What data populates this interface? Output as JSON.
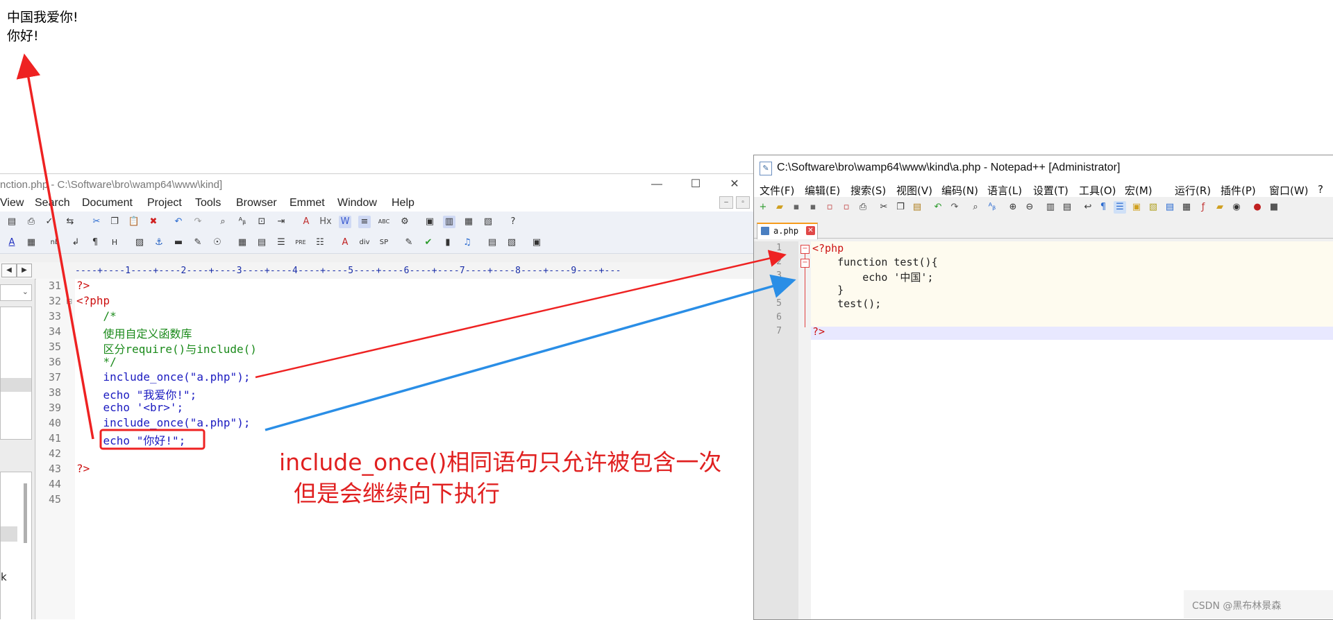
{
  "browser_output": {
    "lines": [
      "中国我爱你!",
      "你好!"
    ]
  },
  "left_window": {
    "title": "nction.php - C:\\Software\\bro\\wamp64\\www\\kind]",
    "window_buttons": [
      "—",
      "☐",
      "✕"
    ],
    "menu": [
      "View",
      "Search",
      "Document",
      "Project",
      "Tools",
      "Browser",
      "Emmet",
      "Window",
      "Help"
    ],
    "ruler": "----+----1----+----2----+----3----+----4----+----5----+----6----+----7----+----8----+----9----+---",
    "side_label": "k",
    "code_lines": [
      {
        "num": "31",
        "text": "?>",
        "color": "#cc1010"
      },
      {
        "num": "32",
        "text": "<?php",
        "color": "#cc1010"
      },
      {
        "num": "33",
        "text": "    /*",
        "color": "#1a8a1a"
      },
      {
        "num": "34",
        "text": "    使用自定义函数库",
        "color": "#1a8a1a"
      },
      {
        "num": "35",
        "text": "    区分require()与include()",
        "color": "#1a8a1a"
      },
      {
        "num": "36",
        "text": "    */",
        "color": "#1a8a1a"
      },
      {
        "num": "37",
        "text": "    include_once(\"a.php\");",
        "color": "#1a1ac0"
      },
      {
        "num": "38",
        "text": "    echo \"我爱你!\";",
        "color": "#1a1ac0"
      },
      {
        "num": "39",
        "text": "    echo '<br>';",
        "color": "#1a1ac0"
      },
      {
        "num": "40",
        "text": "    include_once(\"a.php\");",
        "color": "#1a1ac0"
      },
      {
        "num": "41",
        "text": "    echo \"你好!\";",
        "color": "#1a1ac0"
      },
      {
        "num": "42",
        "text": "",
        "color": "#000000"
      },
      {
        "num": "43",
        "text": "?>",
        "color": "#cc1010"
      },
      {
        "num": "44",
        "text": "",
        "color": "#000000"
      },
      {
        "num": "45",
        "text": "",
        "color": "#000000"
      }
    ]
  },
  "right_window": {
    "title": "C:\\Software\\bro\\wamp64\\www\\kind\\a.php - Notepad++ [Administrator]",
    "menu": [
      "文件(F)",
      "编辑(E)",
      "搜索(S)",
      "视图(V)",
      "编码(N)",
      "语言(L)",
      "设置(T)",
      "工具(O)",
      "宏(M)",
      "运行(R)",
      "插件(P)",
      "窗口(W)",
      "?"
    ],
    "tab_name": "a.php",
    "code_lines": [
      {
        "num": "1",
        "text": "<?php"
      },
      {
        "num": "2",
        "text": "    function test(){"
      },
      {
        "num": "3",
        "text": "        echo '中国';"
      },
      {
        "num": "4",
        "text": "    }"
      },
      {
        "num": "5",
        "text": "    test();"
      },
      {
        "num": "6",
        "text": ""
      },
      {
        "num": "7",
        "text": "?>"
      }
    ]
  },
  "annotation": {
    "line1": "include_once()相同语句只允许被包含一次",
    "line2": "  但是会继续向下执行"
  },
  "watermark": "CSDN @黑布林景森",
  "colors": {
    "arrow_red": "#ee2222",
    "arrow_blue": "#2a8ee6",
    "annotation_red": "#e02020",
    "php_tag": "#cc1010",
    "comment": "#1a8a1a",
    "keyword": "#1a1ac0",
    "string": "#d020d0"
  }
}
